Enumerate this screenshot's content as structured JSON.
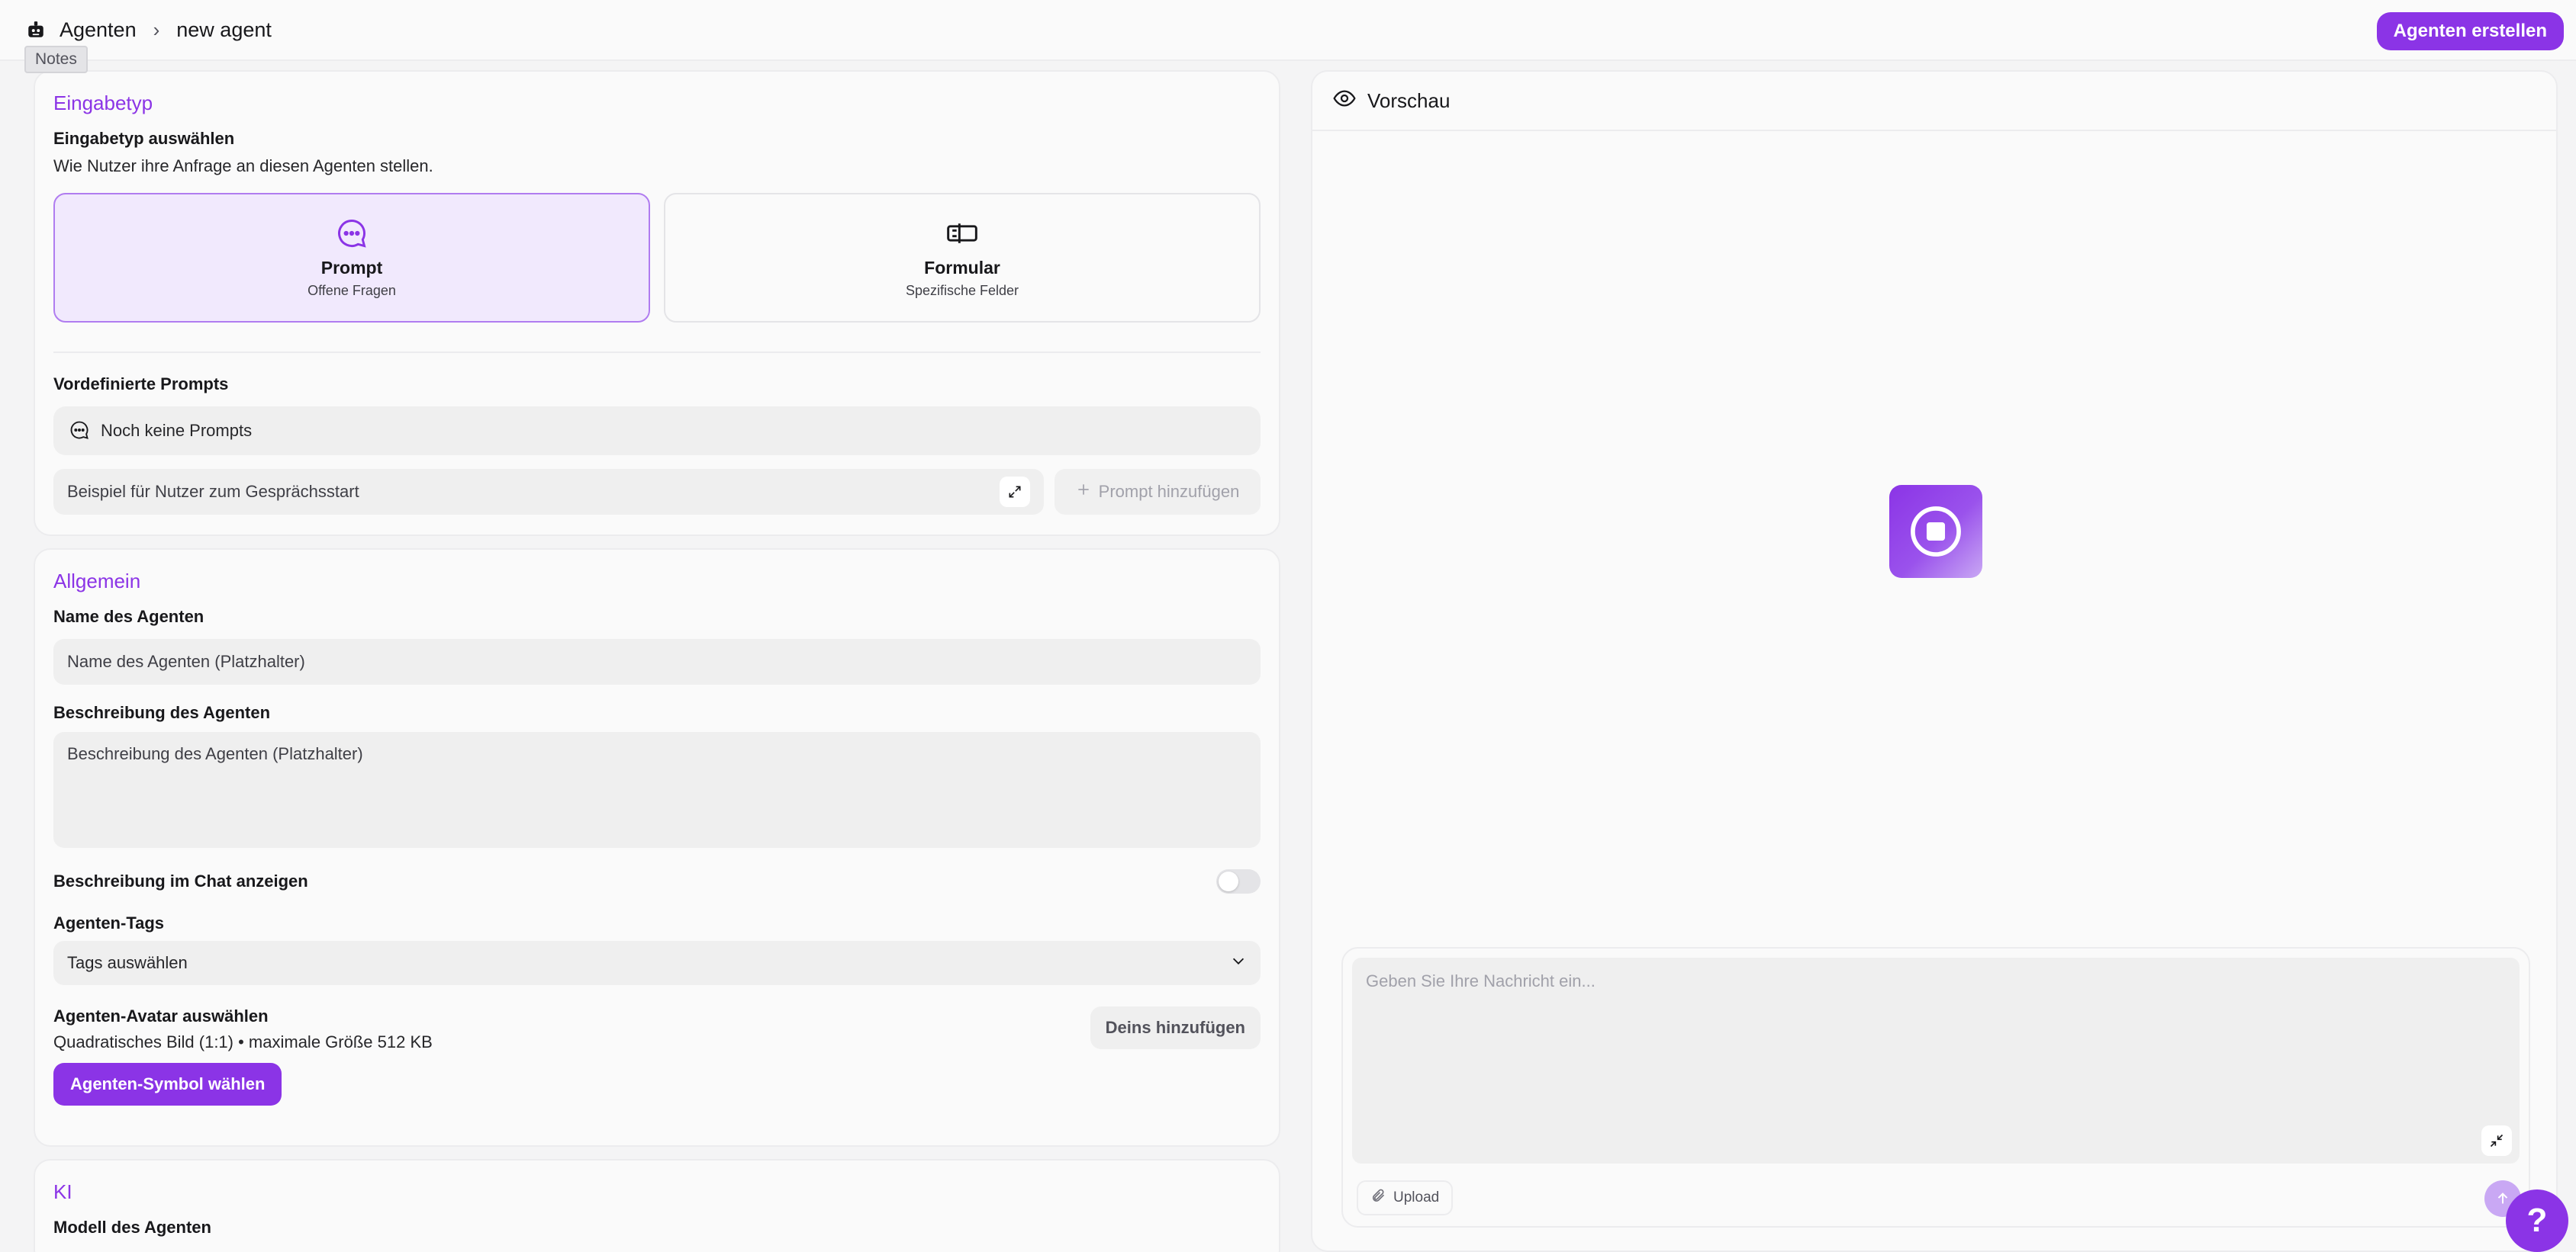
{
  "header": {
    "breadcrumb_root": "Agenten",
    "breadcrumb_current": "new agent",
    "create_button": "Agenten erstellen",
    "tooltip": "Notes"
  },
  "input_type": {
    "section_title": "Eingabetyp",
    "label": "Eingabetyp auswählen",
    "description": "Wie Nutzer ihre Anfrage an diesen Agenten stellen.",
    "options": [
      {
        "title": "Prompt",
        "subtitle": "Offene Fragen",
        "icon": "chat-bubble-icon",
        "selected": true
      },
      {
        "title": "Formular",
        "subtitle": "Spezifische Felder",
        "icon": "form-icon",
        "selected": false
      }
    ]
  },
  "prompts": {
    "label": "Vordefinierte Prompts",
    "empty_text": "Noch keine Prompts",
    "example_placeholder": "Beispiel für Nutzer zum Gesprächsstart",
    "add_button": "Prompt hinzufügen"
  },
  "general": {
    "section_title": "Allgemein",
    "name_label": "Name des Agenten",
    "name_placeholder": "Name des Agenten (Platzhalter)",
    "description_label": "Beschreibung des Agenten",
    "description_placeholder": "Beschreibung des Agenten (Platzhalter)",
    "show_description_label": "Beschreibung im Chat anzeigen",
    "show_description_on": false,
    "tags_label": "Agenten-Tags",
    "tags_placeholder": "Tags auswählen",
    "avatar_label": "Agenten-Avatar auswählen",
    "avatar_hint": "Quadratisches Bild (1:1) • maximale Größe 512 KB",
    "avatar_add_button": "Deins hinzufügen",
    "symbol_button": "Agenten-Symbol wählen"
  },
  "ai": {
    "section_title": "KI",
    "model_label": "Modell des Agenten"
  },
  "preview": {
    "title": "Vorschau",
    "message_placeholder": "Geben Sie Ihre Nachricht ein...",
    "upload_label": "Upload",
    "help_label": "?"
  },
  "colors": {
    "accent": "#8b34e6",
    "accent_light": "#f1e9fd",
    "background": "#f4f4f5"
  }
}
